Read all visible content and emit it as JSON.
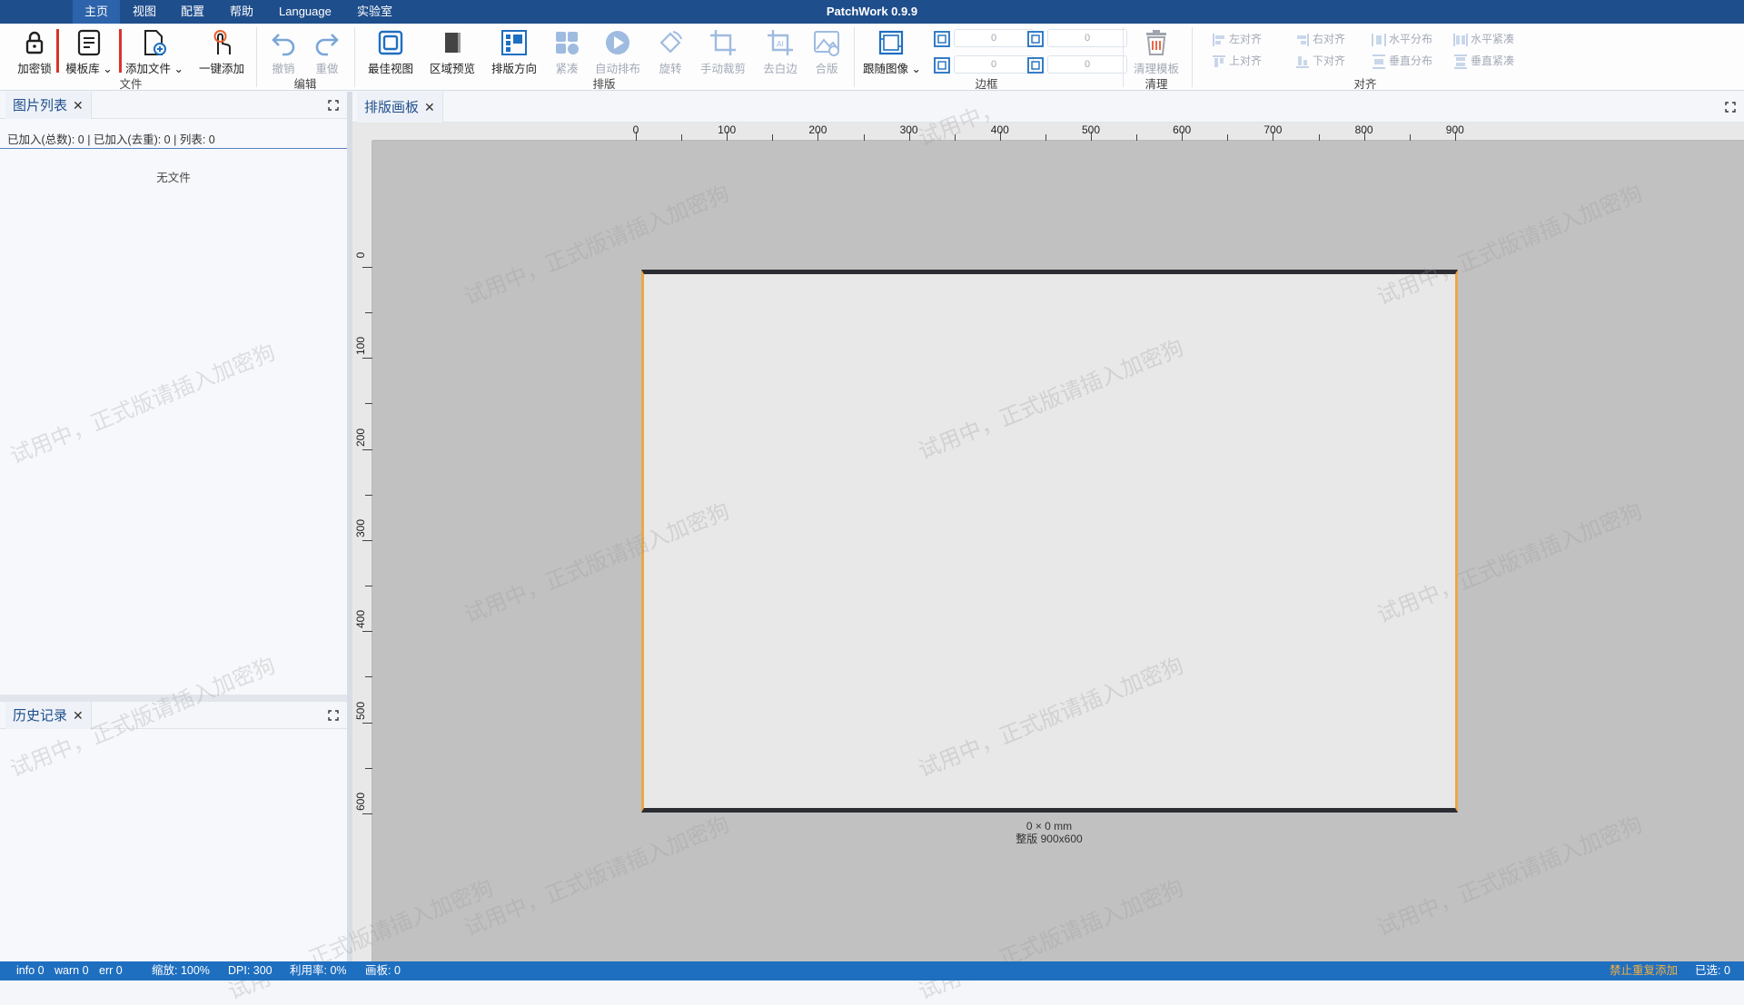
{
  "app_title": "PatchWork 0.9.9",
  "menu": [
    "主页",
    "视图",
    "配置",
    "帮助",
    "Language",
    "实验室"
  ],
  "ribbon": {
    "lock": "加密锁",
    "template_lib": "模板库",
    "add_file": "添加文件",
    "one_click_add": "一键添加",
    "group_file": "文件",
    "undo": "撤销",
    "redo": "重做",
    "group_edit": "编辑",
    "best_view": "最佳视图",
    "region_preview": "区域预览",
    "layout_direction": "排版方向",
    "compact": "紧凑",
    "auto_layout": "自动排布",
    "rotate": "旋转",
    "manual_crop": "手动裁剪",
    "trim_white": "去白边",
    "merge": "合版",
    "group_layout": "排版",
    "follow_image": "跟随图像",
    "border_values": [
      "0",
      "0",
      "0",
      "0"
    ],
    "group_border": "边框",
    "clear_template": "清理模板",
    "group_clear": "清理",
    "align_left": "左对齐",
    "align_top": "上对齐",
    "align_right": "右对齐",
    "align_bottom": "下对齐",
    "h_distribute": "水平分布",
    "v_distribute": "垂直分布",
    "h_compact": "水平紧凑",
    "v_compact": "垂直紧凑",
    "group_align": "对齐"
  },
  "image_list": {
    "tab": "图片列表",
    "counts": "已加入(总数): 0 | 已加入(去重): 0 | 列表: 0",
    "empty": "无文件"
  },
  "history": {
    "tab": "历史记录"
  },
  "canvas": {
    "tab": "排版画板",
    "h_ticks": [
      "0",
      "100",
      "200",
      "300",
      "400",
      "500",
      "600",
      "700",
      "800",
      "900"
    ],
    "v_ticks": [
      "0",
      "100",
      "200",
      "300",
      "400",
      "500",
      "600"
    ],
    "size_mm": "0 × 0 mm",
    "sheet_label": "整版  900x600"
  },
  "watermark": "试用中，正式版请插入加密狗",
  "watermark_fragment": "试用中，",
  "statusbar": {
    "info": "info 0",
    "warn": "warn 0",
    "err": "err 0",
    "zoom": "缩放: 100%",
    "dpi": "DPI: 300",
    "utilization": "利用率: 0%",
    "boards": "画板: 0",
    "no_dup": "禁止重复添加",
    "selected": "已选: 0"
  },
  "colors": {
    "titlebar": "#1f4e8c",
    "statusbar": "#1f6fc0",
    "accent_orange": "#e9a84a",
    "no_dup_text": "#f5b041"
  }
}
